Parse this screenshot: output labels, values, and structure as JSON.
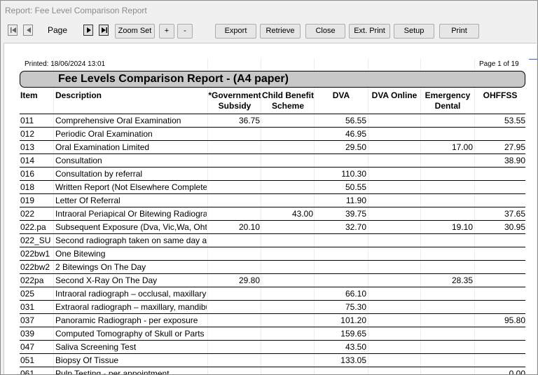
{
  "window": {
    "title": "Report: Fee Level Comparison Report"
  },
  "toolbar": {
    "page_label": "Page",
    "zoom_set": "Zoom Set",
    "zoom_in": "+",
    "zoom_out": "-",
    "export": "Export",
    "retrieve": "Retrieve",
    "close": "Close",
    "ext_print": "Ext. Print",
    "setup": "Setup",
    "print": "Print"
  },
  "report": {
    "printed": "Printed:  18/06/2024 13:01",
    "page_info": "Page 1 of 19",
    "title": "Fee Levels Comparison Report - (A4 paper)",
    "headers": {
      "item": "Item",
      "description": "Description",
      "gov": "*Government Subsidy (NSW)",
      "cbs": "Child Benefit Scheme",
      "dva": "DVA",
      "dva_online": "DVA Online",
      "emergency": "Emergency Dental Scheme",
      "ohffss": "OHFFSS"
    }
  },
  "rows": [
    {
      "item": "011",
      "desc": "Comprehensive Oral Examination",
      "gov": "36.75",
      "cbs": "",
      "dva": "56.55",
      "dvao": "",
      "eds": "",
      "ohf": "53.55"
    },
    {
      "item": "012",
      "desc": "Periodic Oral Examination",
      "gov": "",
      "cbs": "",
      "dva": "46.95",
      "dvao": "",
      "eds": "",
      "ohf": ""
    },
    {
      "item": "013",
      "desc": "Oral Examination Limited",
      "gov": "",
      "cbs": "",
      "dva": "29.50",
      "dvao": "",
      "eds": "17.00",
      "ohf": "27.95"
    },
    {
      "item": "014",
      "desc": "Consultation",
      "gov": "",
      "cbs": "",
      "dva": "",
      "dvao": "",
      "eds": "",
      "ohf": "38.90"
    },
    {
      "item": "016",
      "desc": "Consultation by referral",
      "gov": "",
      "cbs": "",
      "dva": "110.30",
      "dvao": "",
      "eds": "",
      "ohf": ""
    },
    {
      "item": "018",
      "desc": "Written Report (Not Elsewhere Completed)",
      "gov": "",
      "cbs": "",
      "dva": "50.55",
      "dvao": "",
      "eds": "",
      "ohf": ""
    },
    {
      "item": "019",
      "desc": "Letter Of Referral",
      "gov": "",
      "cbs": "",
      "dva": "11.90",
      "dvao": "",
      "eds": "",
      "ohf": ""
    },
    {
      "item": "022",
      "desc": "Intraoral Periapical Or Bitewing Radiograph",
      "gov": "",
      "cbs": "43.00",
      "dva": "39.75",
      "dvao": "",
      "eds": "",
      "ohf": "37.65"
    },
    {
      "item": "022.pa",
      "desc": "Subsequent Exposure (Dva, Vic,Wa, Oht)",
      "gov": "20.10",
      "cbs": "",
      "dva": "32.70",
      "dvao": "",
      "eds": "19.10",
      "ohf": "30.95"
    },
    {
      "item": "022_SU",
      "desc": "Second radiograph taken on same day as",
      "gov": "",
      "cbs": "",
      "dva": "",
      "dvao": "",
      "eds": "",
      "ohf": ""
    },
    {
      "item": "022bw1",
      "desc": "One Bitewing",
      "gov": "",
      "cbs": "",
      "dva": "",
      "dvao": "",
      "eds": "",
      "ohf": ""
    },
    {
      "item": "022bw2",
      "desc": "2 Bitewings On The Day",
      "gov": "",
      "cbs": "",
      "dva": "",
      "dvao": "",
      "eds": "",
      "ohf": ""
    },
    {
      "item": "022pa",
      "desc": "Second X-Ray On The Day",
      "gov": "29.80",
      "cbs": "",
      "dva": "",
      "dvao": "",
      "eds": "28.35",
      "ohf": ""
    },
    {
      "item": "025",
      "desc": "Intraoral radiograph – occlusal, maxillary",
      "gov": "",
      "cbs": "",
      "dva": "66.10",
      "dvao": "",
      "eds": "",
      "ohf": ""
    },
    {
      "item": "031",
      "desc": " Extraoral radiograph – maxillary, mandibular",
      "gov": "",
      "cbs": "",
      "dva": "75.30",
      "dvao": "",
      "eds": "",
      "ohf": ""
    },
    {
      "item": "037",
      "desc": "Panoramic Radiograph - per exposure",
      "gov": "",
      "cbs": "",
      "dva": "101.20",
      "dvao": "",
      "eds": "",
      "ohf": "95.80"
    },
    {
      "item": "039",
      "desc": "Computed Tomography of Skull or Parts",
      "gov": "",
      "cbs": "",
      "dva": "159.65",
      "dvao": "",
      "eds": "",
      "ohf": ""
    },
    {
      "item": "047",
      "desc": "Saliva Screening Test",
      "gov": "",
      "cbs": "",
      "dva": "43.50",
      "dvao": "",
      "eds": "",
      "ohf": ""
    },
    {
      "item": "051",
      "desc": "Biopsy Of Tissue",
      "gov": "",
      "cbs": "",
      "dva": "133.05",
      "dvao": "",
      "eds": "",
      "ohf": ""
    },
    {
      "item": "061",
      "desc": "Pulp Testing - per appointment",
      "gov": "",
      "cbs": "",
      "dva": "",
      "dvao": "",
      "eds": "",
      "ohf": "0.00"
    }
  ]
}
